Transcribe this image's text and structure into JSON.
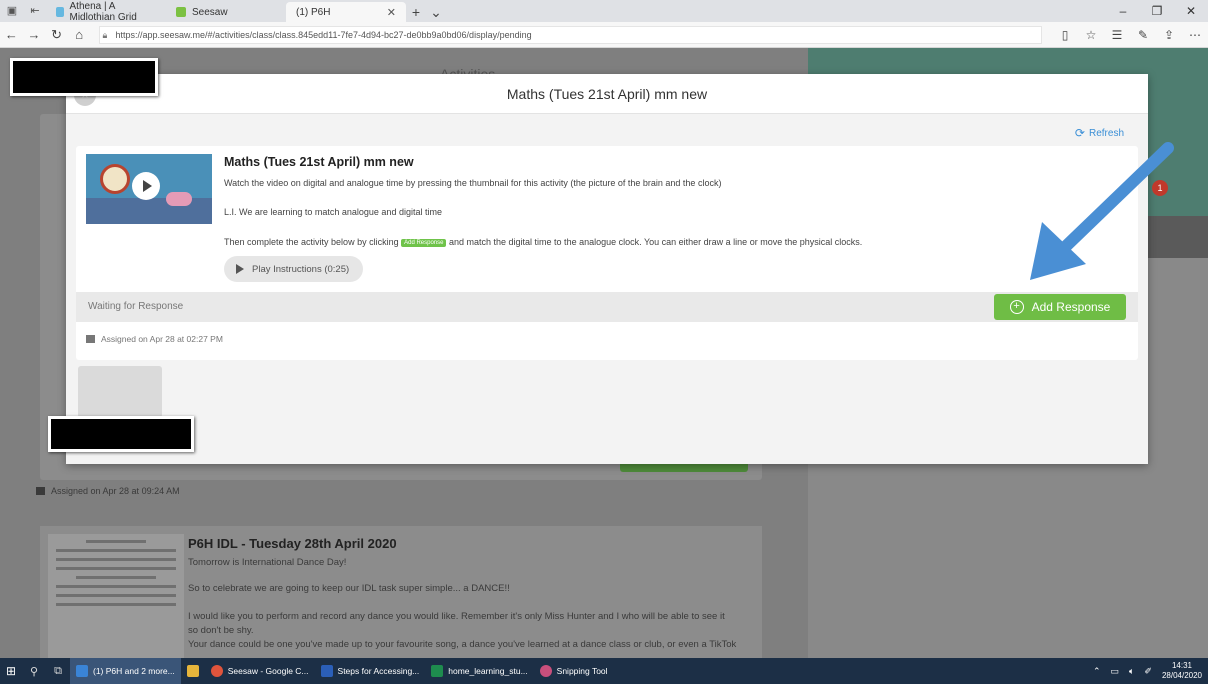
{
  "browser": {
    "tabs": [
      {
        "label": "Athena | A Midlothian Grid",
        "active": false
      },
      {
        "label": "Seesaw",
        "active": false
      },
      {
        "label": "(1) P6H",
        "active": true
      }
    ],
    "url": "https://app.seesaw.me/#/activities/class/class.845edd11-7fe7-4d94-bc27-de0bb9a0bd06/display/pending"
  },
  "page": {
    "title": "Activities",
    "notification_count": "1",
    "bg_assigned": "Assigned on Apr 28 at 09:24 AM",
    "card2": {
      "title": "P6H IDL - Tuesday 28th April 2020",
      "lines": [
        "Tomorrow is International Dance Day!",
        "So to celebrate we are going to keep our IDL task super simple... a DANCE!!",
        "I would like you to perform and record any dance you would like. Remember it's only Miss Hunter and I who will be able to see it",
        "so don't be shy.",
        "Your dance could be one you've made up to your favourite song, a dance you've learned at a dance class or club, or even a TikTok"
      ]
    }
  },
  "modal": {
    "title": "Maths (Tues 21st April) mm new",
    "close_icon": "×",
    "refresh_label": "Refresh",
    "activity": {
      "title": "Maths (Tues 21st April) mm new",
      "line1": "Watch the video on digital and analogue time by pressing the thumbnail for this activity (the picture of the brain and the clock)",
      "line2": "L.I. We are learning to match analogue and digital time",
      "line3_before": "Then complete the activity below by clicking",
      "inline_button": "Add Response",
      "line3_after": "and match the digital time to the analogue clock. You can either draw a line or move the physical clocks.",
      "play_instructions": "Play Instructions (0:25)"
    },
    "response": {
      "status": "Waiting for Response",
      "add_response_label": "Add Response"
    },
    "assigned": "Assigned on Apr 28 at 02:27 PM"
  },
  "taskbar": {
    "apps": [
      {
        "label": "(1) P6H and 2 more...",
        "color": "#3a84d6",
        "active": true
      },
      {
        "label": "",
        "color": "#e6b53b",
        "active": false
      },
      {
        "label": "Seesaw - Google C...",
        "color": "#e0543c",
        "active": false
      },
      {
        "label": "Steps for Accessing...",
        "color": "#2b5fb8",
        "active": false
      },
      {
        "label": "home_learning_stu...",
        "color": "#1e8c4e",
        "active": false
      },
      {
        "label": "Snipping Tool",
        "color": "#c94f7c",
        "active": false
      }
    ],
    "time": "14:31",
    "date": "28/04/2020"
  },
  "colors": {
    "accent_green": "#6fbd45",
    "link_blue": "#3b8fd6",
    "arrow_blue": "#4a8fd4"
  }
}
